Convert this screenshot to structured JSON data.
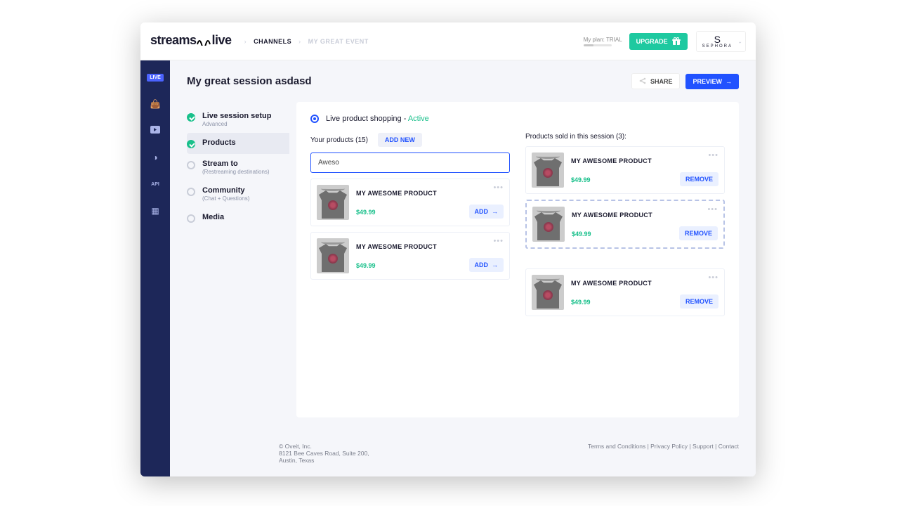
{
  "header": {
    "logo_text": "streams",
    "logo_suffix": "live",
    "crumb_channels": "CHANNELS",
    "crumb_event": "MY GREAT EVENT",
    "plan_label": "My plan:",
    "plan_value": "TRIAL",
    "upgrade_label": "UPGRADE",
    "brand_name": "SEPHORA"
  },
  "rail": {
    "live_label": "LIVE"
  },
  "titlebar": {
    "title": "My great session asdasd",
    "share_label": "SHARE",
    "preview_label": "PREVIEW"
  },
  "steps": [
    {
      "label": "Live session setup",
      "sub": "Advanced",
      "done": true
    },
    {
      "label": "Products",
      "sub": "",
      "done": true,
      "active": true
    },
    {
      "label": "Stream to",
      "sub": "(Restreaming destinations)"
    },
    {
      "label": "Community",
      "sub": "(Chat + Questions)"
    },
    {
      "label": "Media",
      "sub": ""
    }
  ],
  "content": {
    "heading": "Live product shopping -",
    "status": "Active",
    "left": {
      "count_label": "Your products (15)",
      "addnew_label": "ADD NEW",
      "search_value": "Aweso",
      "add_label": "ADD",
      "items": [
        {
          "name": "MY AWESOME PRODUCT",
          "price": "$49.99"
        },
        {
          "name": "MY AWESOME PRODUCT",
          "price": "$49.99"
        }
      ]
    },
    "right": {
      "count_label": "Products sold in this session (3):",
      "remove_label": "REMOVE",
      "items": [
        {
          "name": "MY AWESOME PRODUCT",
          "price": "$49.99"
        },
        {
          "name": "MY AWESOME PRODUCT",
          "price": "$49.99",
          "dashed": true
        },
        {
          "name": "MY AWESOME PRODUCT",
          "price": "$49.99",
          "spaced": true
        }
      ]
    }
  },
  "footer": {
    "copyright": "© Oveit, Inc.",
    "addr1": "8121 Bee Caves Road, Suite 200,",
    "addr2": "Austin, Texas",
    "links": [
      "Terms and Conditions",
      "Privacy Policy",
      "Support",
      "Contact"
    ]
  }
}
